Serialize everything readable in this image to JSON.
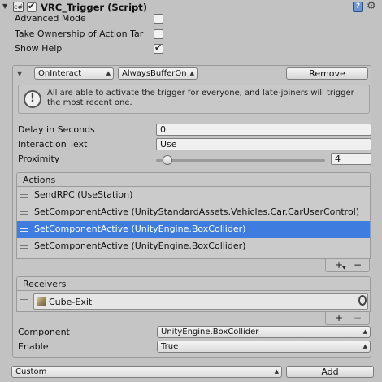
{
  "header": {
    "title": "VRC_Trigger (Script)",
    "enabled": true
  },
  "options": [
    {
      "label": "Advanced Mode",
      "checked": false
    },
    {
      "label": "Take Ownership of Action Tar",
      "checked": false
    },
    {
      "label": "Show Help",
      "checked": true
    }
  ],
  "trigger": {
    "type_value": "OnInteract",
    "broadcast_value": "AlwaysBufferOn",
    "remove_label": "Remove",
    "help_text": "All are able to activate the trigger for everyone, and late-joiners will trigger the most recent one."
  },
  "fields": {
    "delay_label": "Delay in Seconds",
    "delay_value": "0",
    "interaction_label": "Interaction Text",
    "interaction_value": "Use",
    "proximity_label": "Proximity",
    "proximity_value": "4",
    "proximity_fraction": 0.04
  },
  "actions": {
    "title": "Actions",
    "items": [
      "SendRPC (UseStation)",
      "SetComponentActive (UnityStandardAssets.Vehicles.Car.CarUserControl)",
      "SetComponentActive (UnityEngine.BoxCollider)",
      "SetComponentActive (UnityEngine.BoxCollider)"
    ],
    "selected_index": 2,
    "add_symbol": "+",
    "remove_symbol": "−"
  },
  "receivers": {
    "title": "Receivers",
    "object_name": "Cube-Exit",
    "add_symbol": "+",
    "remove_symbol": "−"
  },
  "component": {
    "label": "Component",
    "value": "UnityEngine.BoxCollider"
  },
  "enable": {
    "label": "Enable",
    "value": "True"
  },
  "bottom": {
    "custom_value": "Custom",
    "add_label": "Add"
  },
  "colors": {
    "selection": "#3e7ce0",
    "panel_bg": "#c2c2c2"
  }
}
